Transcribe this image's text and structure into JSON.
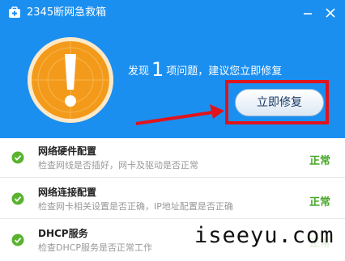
{
  "window": {
    "title": "2345断网急救箱",
    "icons": {
      "app": "first-aid-kit-icon",
      "minimize": "minimize-icon",
      "close": "close-icon",
      "alert": "exclamation-icon",
      "arrow": "red-arrow-icon",
      "ok": "check-circle-icon"
    }
  },
  "summary": {
    "prefix": "发现",
    "count": "1",
    "suffix": "项问题，建议您立即修复"
  },
  "fix_button": {
    "label": "立即修复"
  },
  "checks": [
    {
      "title": "网络硬件配置",
      "description": "检查网线是否插好，网卡及驱动是否正常",
      "status": "正常"
    },
    {
      "title": "网络连接配置",
      "description": "检查网卡相关设置是否正确，IP地址配置是否正确",
      "status": "正常"
    },
    {
      "title": "DHCP服务",
      "description": "检查DHCP服务是否正常工作",
      "status": "正常"
    }
  ],
  "watermark": "iseeyu.com",
  "colors": {
    "header_bg": "#1b8ff0",
    "alert_orange": "#f39a1a",
    "status_green": "#4aa82a",
    "highlight_red": "#e0141c"
  }
}
